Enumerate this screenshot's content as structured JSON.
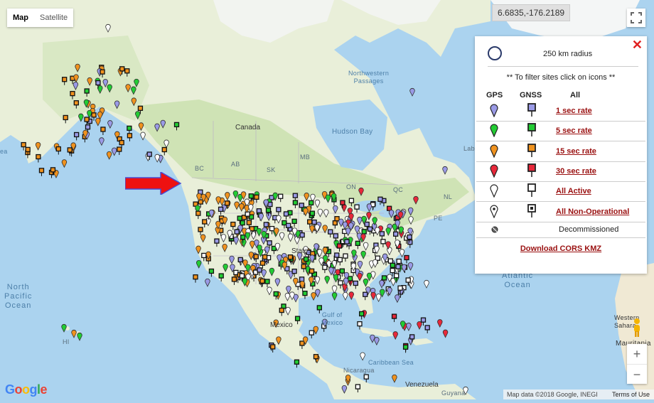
{
  "map_controls": {
    "map_label": "Map",
    "satellite_label": "Satellite",
    "coordinates": "6.6835,-176.2189"
  },
  "legend": {
    "radius_label": "250 km radius",
    "hint": "** To filter sites click on icons **",
    "col_gps": "GPS",
    "col_gnss": "GNSS",
    "col_all": "All",
    "rows": [
      {
        "label": "1 sec rate",
        "color": "#9a9ae6"
      },
      {
        "label": "5 sec rate",
        "color": "#22cc33"
      },
      {
        "label": "15 sec rate",
        "color": "#f0921e"
      },
      {
        "label": "30 sec rate",
        "color": "#e8283a"
      },
      {
        "label": "All Active",
        "color": "#ffffff"
      },
      {
        "label": "All Non-Operational",
        "color": "#ffffff"
      }
    ],
    "decommissioned_label": "Decommissioned",
    "download_label": "Download CORS KMZ"
  },
  "labels": {
    "canada": "Canada",
    "hudson_bay": "Hudson Bay",
    "northwestern_passages": "Northwestern\nPassages",
    "bc": "BC",
    "ab": "AB",
    "sk": "SK",
    "mb": "MB",
    "on": "ON",
    "qc": "QC",
    "nl": "NL",
    "pe": "PE",
    "labrador": "Lab",
    "states": "States",
    "mexico": "Mexico",
    "gulf_of_mexico": "Gulf of\nMexico",
    "caribbean_sea": "Caribbean Sea",
    "nicaragua": "Nicaragua",
    "venezuela": "Venezuela",
    "guyana": "Guyana",
    "hi": "HI",
    "north_pacific_ocean": "North\nPacific\nOcean",
    "atlantic_ocean": "Atlantic\nOcean",
    "western_sahara": "Western\nSahara",
    "mauritania": "Mauritania",
    "ea": "ea"
  },
  "footer": {
    "google_logo": "Google",
    "attribution": "Map data ©2018 Google, INEGI",
    "terms": "Terms of Use"
  },
  "zoom": {
    "in": "+",
    "out": "−"
  },
  "colors": {
    "ocean": "#abd3ef",
    "land": "#e9efd9",
    "forest": "#cfe3b5",
    "ice": "#f4f6f6",
    "arrow": "#ee1111"
  }
}
